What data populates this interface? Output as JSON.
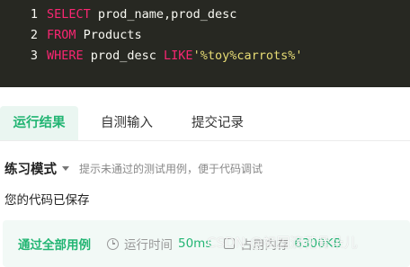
{
  "editor": {
    "lines": [
      {
        "no": "1",
        "parts": [
          {
            "t": "SELECT",
            "k": "kw"
          },
          {
            "t": " prod_name,prod_desc",
            "k": ""
          }
        ]
      },
      {
        "no": "2",
        "parts": [
          {
            "t": "FROM",
            "k": "kw"
          },
          {
            "t": " Products",
            "k": ""
          }
        ]
      },
      {
        "no": "3",
        "parts": [
          {
            "t": "WHERE",
            "k": "kw"
          },
          {
            "t": " prod_desc ",
            "k": ""
          },
          {
            "t": "LIKE",
            "k": "kw"
          },
          {
            "t": "'%toy%carrots%'",
            "k": "str"
          }
        ]
      }
    ]
  },
  "tabs": {
    "run_result": "运行结果",
    "self_test": "自测输入",
    "submissions": "提交记录"
  },
  "mode": {
    "label": "练习模式",
    "hint": "提示未通过的测试用例，便于代码调试"
  },
  "status": {
    "saved": "您的代码已保存"
  },
  "result": {
    "passed": "通过全部用例",
    "time_label": "运行时间",
    "time_value": "50ms",
    "memory_label": "占用内存",
    "memory_value": "6300KB"
  },
  "watermark": "CSDN @祖国滴花骨朵儿",
  "colors": {
    "accent": "#22b573",
    "editor_bg": "#272822",
    "keyword": "#f92672",
    "string": "#e6db74"
  }
}
